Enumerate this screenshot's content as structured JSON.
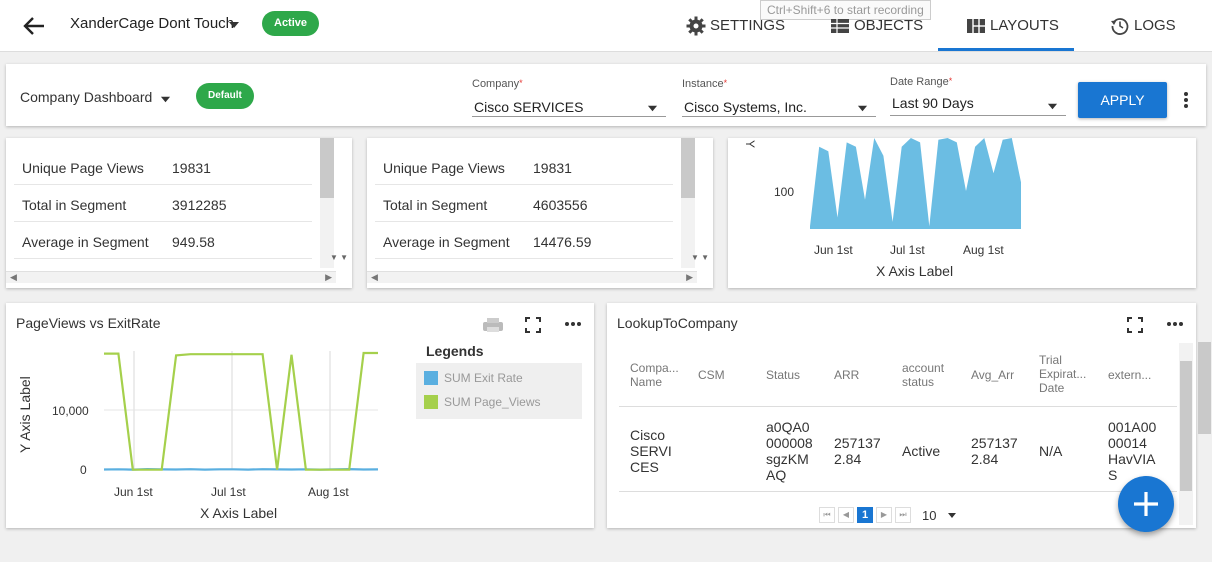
{
  "header": {
    "project_name": "XanderCage Dont Touch",
    "status_badge": "Active",
    "recording_hint": "Ctrl+Shift+6 to start recording",
    "tabs": [
      {
        "label": "SETTINGS",
        "icon": "gear-icon"
      },
      {
        "label": "OBJECTS",
        "icon": "table-icon"
      },
      {
        "label": "LAYOUTS",
        "icon": "layout-grid-icon",
        "selected": true
      },
      {
        "label": "LOGS",
        "icon": "history-icon"
      }
    ]
  },
  "filters": {
    "dashboard_name": "Company Dashboard",
    "dashboard_badge": "Default",
    "company": {
      "label": "Company",
      "required_mark": "*",
      "value": "Cisco SERVICES"
    },
    "instance": {
      "label": "Instance",
      "required_mark": "*",
      "value": "Cisco Systems, Inc."
    },
    "date_range": {
      "label": "Date Range",
      "required_mark": "*",
      "value": "Last 90 Days"
    },
    "apply_label": "APPLY"
  },
  "stats_card_1": {
    "rows": [
      {
        "key": "Unique Page Views",
        "value": "19831"
      },
      {
        "key": "Total in Segment",
        "value": "3912285"
      },
      {
        "key": "Average in Segment",
        "value": "949.58"
      }
    ]
  },
  "stats_card_2": {
    "rows": [
      {
        "key": "Unique Page Views",
        "value": "19831"
      },
      {
        "key": "Total in Segment",
        "value": "4603556"
      },
      {
        "key": "Average in Segment",
        "value": "14476.59"
      }
    ]
  },
  "area_card": {
    "xlabel": "X Axis Label",
    "ylabel_partial": "Y",
    "ytick": "100",
    "xticks": [
      "Jun 1st",
      "Jul 1st",
      "Aug 1st"
    ]
  },
  "pageviews_card": {
    "title": "PageViews vs ExitRate",
    "legend_title": "Legends",
    "legend_items": [
      {
        "label": "SUM Exit Rate",
        "color": "#5aafe0"
      },
      {
        "label": "SUM Page_Views",
        "color": "#a5d04c"
      }
    ]
  },
  "lookup_card": {
    "title": "LookupToCompany",
    "headers": [
      [
        "Compa...",
        "Name"
      ],
      [
        "CSM"
      ],
      [
        "Status"
      ],
      [
        "ARR"
      ],
      [
        "account",
        "status"
      ],
      [
        "Avg_Arr"
      ],
      [
        "Trial",
        "Expirat...",
        "Date"
      ],
      [
        "extern..."
      ]
    ],
    "row": [
      [
        "Cisco",
        "SERVI",
        "CES"
      ],
      [
        ""
      ],
      [
        "a0QA0",
        "000008",
        "sgzKM",
        "AQ"
      ],
      [
        "257137",
        "2.84"
      ],
      [
        "Active"
      ],
      [
        "257137",
        "2.84"
      ],
      [
        "N/A"
      ],
      [
        "001A00",
        "00014",
        "HavVIA",
        "S"
      ]
    ],
    "pager": {
      "current_page": "1",
      "page_size": "10"
    }
  },
  "chart_data": [
    {
      "type": "area",
      "title": "",
      "xlabel": "X Axis Label",
      "ylabel": "Y",
      "x_ticks": [
        "Jun 1st",
        "Jul 1st",
        "Aug 1st"
      ],
      "y_ticks": [
        100
      ],
      "series": [
        {
          "color": "#6bbde3",
          "values": [
            60,
            150,
            145,
            70,
            155,
            150,
            90,
            160,
            140,
            65,
            150,
            160,
            155,
            60,
            158,
            160,
            155,
            100,
            150,
            160,
            120,
            158,
            160,
            110
          ]
        }
      ]
    },
    {
      "type": "line",
      "title": "PageViews vs ExitRate",
      "xlabel": "X Axis Label",
      "ylabel": "Y Axis Label",
      "x_ticks": [
        "Jun 1st",
        "Jul 1st",
        "Aug 1st"
      ],
      "y_ticks": [
        0,
        10000
      ],
      "ylim": [
        0,
        20000
      ],
      "legend": "right",
      "series": [
        {
          "name": "SUM Exit Rate",
          "color": "#5aafe0",
          "values": [
            80,
            120,
            60,
            150,
            100,
            90,
            140,
            60,
            120,
            110,
            70,
            130,
            100,
            80,
            120,
            60,
            110,
            150,
            90,
            100
          ]
        },
        {
          "name": "SUM Page_Views",
          "color": "#a5d04c",
          "values": [
            19400,
            19400,
            50,
            50,
            50,
            19100,
            19300,
            19300,
            19300,
            19300,
            19300,
            19300,
            50,
            19200,
            50,
            50,
            50,
            50,
            19500,
            19500
          ]
        }
      ]
    }
  ]
}
